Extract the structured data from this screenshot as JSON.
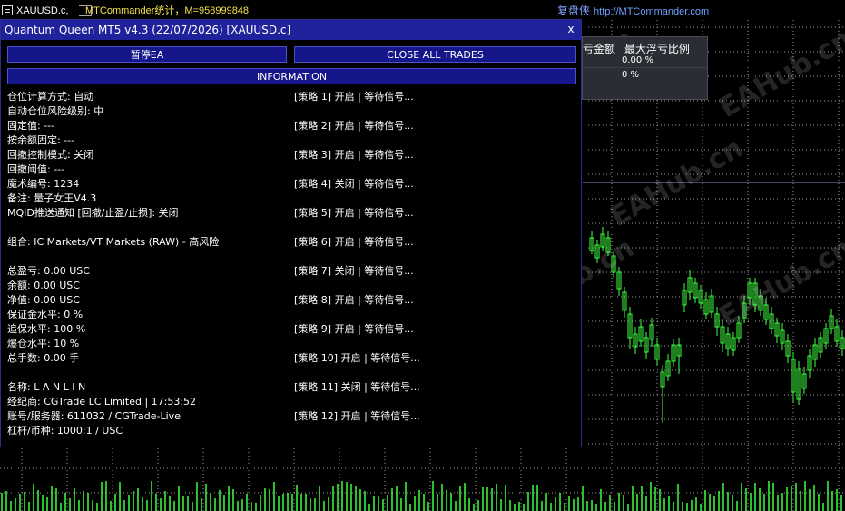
{
  "top_bar": {
    "tab_label": "XAUUSD.c,",
    "mtc_title": "MTCommander统计，M=958999848",
    "right_cn": "复盘侠",
    "right_url": "http://MTCommander.com"
  },
  "stats_panel": {
    "col1_header": "亏金额",
    "col2_header": "最大浮亏比例",
    "row1_value": "0.00 %",
    "row2_value": "0 %"
  },
  "ea_window": {
    "title": "Quantum Queen MT5 v4.3 (22/07/2026) [XAUUSD.c]",
    "minimize_glyph": "_",
    "close_glyph": "x",
    "pause_button": "暂停EA",
    "close_all_button": "CLOSE ALL TRADES",
    "info_button": "INFORMATION"
  },
  "info_lines": [
    "仓位计算方式: 自动",
    "自动仓位风险级别: 中",
    "固定值: ---",
    "按余额固定: ---",
    "回撤控制模式: 关闭",
    "回撤阈值: ---",
    "魔术编号: 1234",
    "备注: 量子女王V4.3",
    "MQID推送通知 [回撤/止盈/止损]: 关闭",
    "组合: IC Markets/VT Markets (RAW) - 高风险",
    "总盈亏: 0.00 USC",
    "余额: 0.00 USC",
    "净值: 0.00 USC",
    "保证金水平: 0 %",
    "追保水平: 100 %",
    "爆仓水平: 10 %",
    "总手数: 0.00 手",
    "名称: L A N L I N",
    "经纪商: CGTrade LC Limited | 17:53:52",
    "账号/服务器: 611032 / CGTrade-Live",
    "杠杆/币种: 1000:1 / USC"
  ],
  "strategies": [
    "[策略 1] 开启 | 等待信号...",
    "[策略 2] 开启 | 等待信号...",
    "[策略 3] 开启 | 等待信号...",
    "[策略 4] 关闭 | 等待信号...",
    "[策略 5] 开启 | 等待信号...",
    "[策略 6] 开启 | 等待信号...",
    "[策略 7] 关闭 | 等待信号...",
    "[策略 8] 开启 | 等待信号...",
    "[策略 9] 开启 | 等待信号...",
    "[策略 10] 开启 | 等待信号...",
    "[策略 11] 关闭 | 等待信号...",
    "[策略 12] 开启 | 等待信号..."
  ],
  "colors": {
    "candle": "#3cff3c",
    "grid": "#cfcfcf",
    "title_bar": "#1f229a",
    "button_bg": "#14168a",
    "mtc_title": "#f2e24a",
    "link": "#5f8cff"
  },
  "watermark": "EAHub.cn"
}
